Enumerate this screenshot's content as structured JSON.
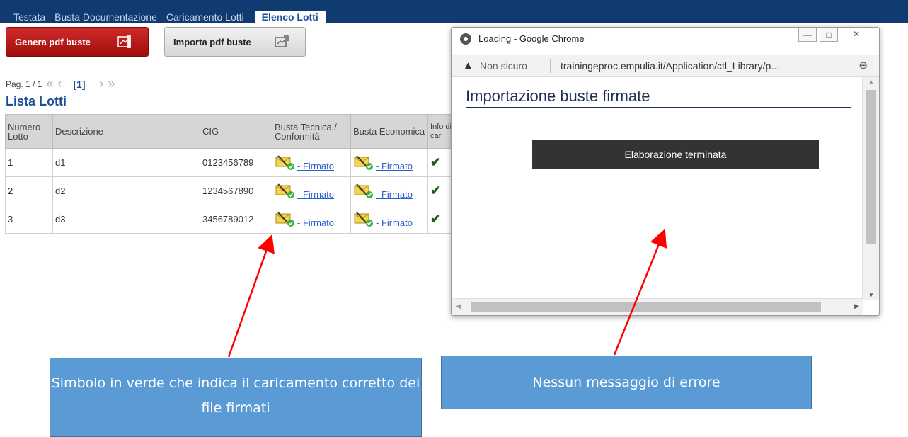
{
  "tabs": [
    {
      "label": "Testata"
    },
    {
      "label": "Busta Documentazione"
    },
    {
      "label": "Caricamento Lotti"
    },
    {
      "label": "Elenco Lotti"
    }
  ],
  "toolbar": {
    "genera_label": "Genera pdf buste",
    "importa_label": "Importa pdf buste"
  },
  "pager": {
    "page_text": "Pag. 1 / 1",
    "current": "[1]",
    "first_icon": "double-chevron-left-icon",
    "prev_icon": "chevron-left-icon",
    "next_icon": "chevron-right-icon",
    "last_icon": "double-chevron-right-icon"
  },
  "list_title": "Lista Lotti",
  "table": {
    "headers": [
      "Numero Lotto",
      "Descrizione",
      "CIG",
      "Busta Tecnica / Conformità",
      "Busta Economica",
      "Info di cari"
    ],
    "rows": [
      {
        "numero": "1",
        "descrizione": "d1",
        "cig": "0123456789",
        "tecnica": "- Firmato",
        "economica": "- Firmato",
        "check": "✔"
      },
      {
        "numero": "2",
        "descrizione": "d2",
        "cig": "1234567890",
        "tecnica": "- Firmato",
        "economica": "- Firmato",
        "check": "✔"
      },
      {
        "numero": "3",
        "descrizione": "d3",
        "cig": "3456789012",
        "tecnica": "- Firmato",
        "economica": "- Firmato",
        "check": "✔"
      }
    ]
  },
  "popup": {
    "window_title": "Loading - Google Chrome",
    "not_secure": "Non sicuro",
    "url": "trainingeproc.empulia.it/Application/ctl_Library/p...",
    "heading": "Importazione buste firmate",
    "message": "Elaborazione terminata"
  },
  "annotations": {
    "left_callout": "Simbolo in verde che indica il caricamento corretto dei file firmati",
    "right_callout": "Nessun messaggio di errore"
  },
  "colors": {
    "topbar": "#0f3b70",
    "accent_blue": "#1a4f9a",
    "red_button": "#c01c1c",
    "callout_fill": "#5b9bd5",
    "arrow": "#ff0000"
  }
}
